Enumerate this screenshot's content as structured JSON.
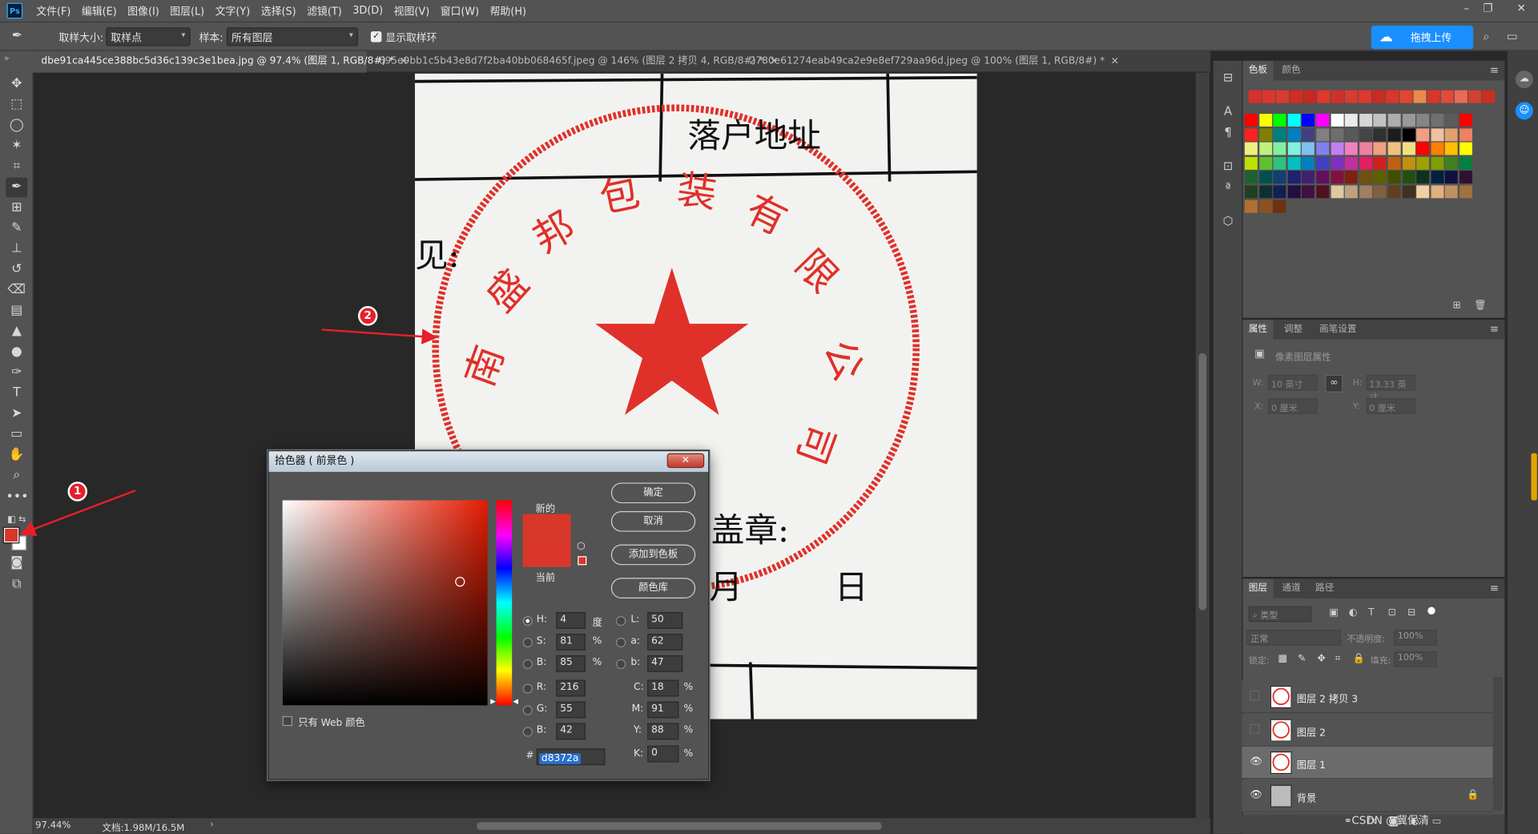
{
  "menubar": {
    "items": [
      "文件(F)",
      "编辑(E)",
      "图像(I)",
      "图层(L)",
      "文字(Y)",
      "选择(S)",
      "滤镜(T)",
      "3D(D)",
      "视图(V)",
      "窗口(W)",
      "帮助(H)"
    ]
  },
  "options": {
    "sample_size_label": "取样大小:",
    "sample_size_value": "取样点",
    "sample_label": "样本:",
    "sample_value": "所有图层",
    "show_ring_label": "显示取样环",
    "upload_label": "拖拽上传"
  },
  "tabs": [
    {
      "label": "dbe91ca445ce388bc5d36c139c3e1bea.jpg @ 97.4% (图层 1, RGB/8#) *",
      "active": true
    },
    {
      "label": "695e9bb1c5b43e8d7f2ba40bb068465f.jpeg @ 146% (图层 2 拷贝 4, RGB/8#) *",
      "active": false
    },
    {
      "label": "2780e61274eab49ca2e9e8ef729aa96d.jpeg @ 100% (图层 1, RGB/8#) *",
      "active": false
    }
  ],
  "canvas_texts": {
    "header": "落户地址",
    "opinion": "见:",
    "seal_chars": "盖章:",
    "day": "日",
    "month": "月",
    "ring": [
      "南",
      "盛",
      "邦",
      "包",
      "装",
      "有",
      "限",
      "公",
      "司"
    ]
  },
  "status": {
    "zoom": "97.44%",
    "doc": "文档:1.98M/16.5M"
  },
  "panels": {
    "swatches_tabs": [
      "色板",
      "颜色"
    ],
    "props_tabs": [
      "属性",
      "调整",
      "画笔设置"
    ],
    "props_title": "像素图层属性",
    "w_label": "W:",
    "w_value": "10 英寸",
    "h_label": "H:",
    "h_value": "13.33 英寸",
    "x_label": "X:",
    "x_value": "0 厘米",
    "y_label": "Y:",
    "y_value": "0 厘米",
    "layers_tabs": [
      "图层",
      "通道",
      "路径"
    ],
    "filter_label": "类型",
    "blend_mode": "正常",
    "opacity_label": "不透明度:",
    "opacity_value": "100%",
    "lock_label": "锁定:",
    "fill_label": "填充:",
    "fill_value": "100%"
  },
  "layers": [
    {
      "name": "图层 2 拷贝 3",
      "visible": false,
      "selected": false
    },
    {
      "name": "图层 2",
      "visible": false,
      "selected": false
    },
    {
      "name": "图层 1",
      "visible": true,
      "selected": true
    },
    {
      "name": "背景",
      "visible": true,
      "selected": false,
      "locked": true
    }
  ],
  "picker": {
    "title": "拾色器 ( 前景色 )",
    "new_label": "新的",
    "current_label": "当前",
    "ok": "确定",
    "cancel": "取消",
    "add_swatch": "添加到色板",
    "color_libs": "颜色库",
    "web_only": "只有 Web 颜色",
    "H_label": "H:",
    "H": "4",
    "H_unit": "度",
    "S_label": "S:",
    "S": "81",
    "S_unit": "%",
    "Bv_label": "B:",
    "Bv": "85",
    "Bv_unit": "%",
    "R_label": "R:",
    "R": "216",
    "G_label": "G:",
    "G": "55",
    "Bc_label": "B:",
    "Bc": "42",
    "L_label": "L:",
    "L": "50",
    "a_label": "a:",
    "a": "62",
    "b_label": "b:",
    "b": "47",
    "C_label": "C:",
    "C": "18",
    "C_unit": "%",
    "M_label": "M:",
    "M": "91",
    "M_unit": "%",
    "Y_label": "Y:",
    "Y": "88",
    "Y_unit": "%",
    "K_label": "K:",
    "K": "0",
    "K_unit": "%",
    "hash": "#",
    "hex": "d8372a"
  },
  "annotations": {
    "badge1": "1",
    "badge2": "2"
  },
  "watermark": "CSDN @冀保清",
  "colors": {
    "foreground": "#d8372a",
    "accent": "#1a8fff",
    "annotation": "#e4202a"
  }
}
